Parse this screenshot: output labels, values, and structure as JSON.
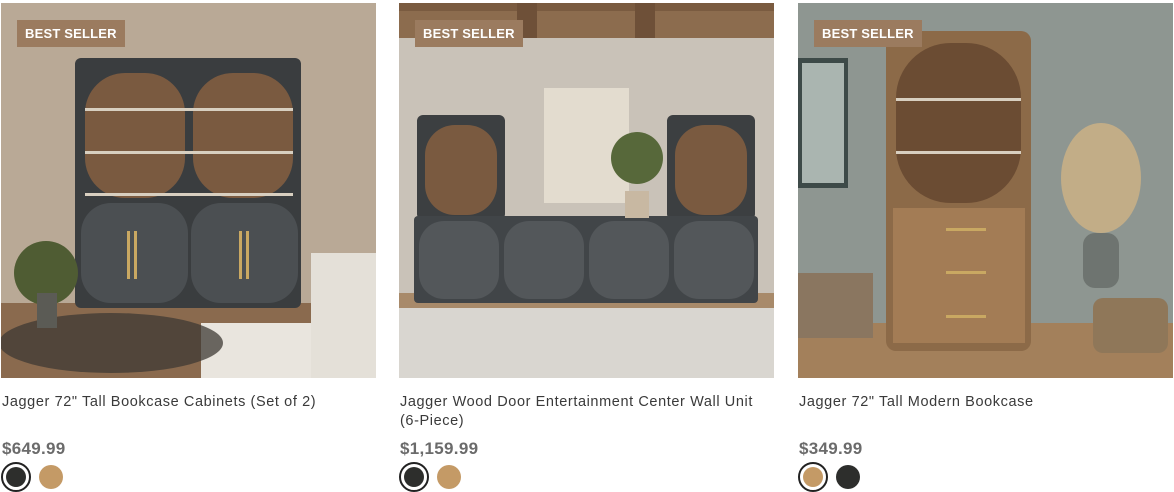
{
  "products": [
    {
      "badge": "BEST SELLER",
      "name": "Jagger 72\" Tall Bookcase Cabinets (Set of 2)",
      "price": "$649.99",
      "swatches": [
        {
          "color": "#2d2e2c",
          "selected": true
        },
        {
          "color": "#c49a66",
          "selected": false
        }
      ]
    },
    {
      "badge": "BEST SELLER",
      "name": "Jagger Wood Door Entertainment Center Wall Unit (6-Piece)",
      "price": "$1,159.99",
      "swatches": [
        {
          "color": "#2d2e2c",
          "selected": true
        },
        {
          "color": "#c49a66",
          "selected": false
        }
      ]
    },
    {
      "badge": "BEST SELLER",
      "name": "Jagger 72\" Tall Modern Bookcase",
      "price": "$349.99",
      "swatches": [
        {
          "color": "#c49a66",
          "selected": true
        },
        {
          "color": "#2d2e2c",
          "selected": false
        }
      ]
    }
  ]
}
